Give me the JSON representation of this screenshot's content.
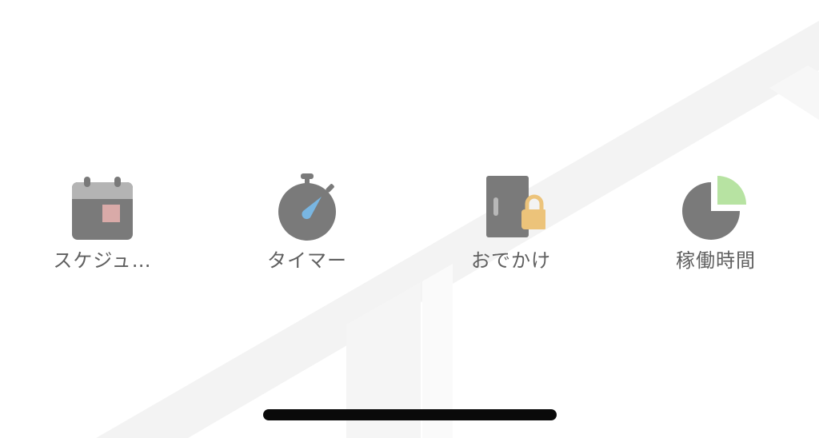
{
  "menu": {
    "items": [
      {
        "id": "schedule",
        "label": "スケジュ…",
        "icon": "calendar-icon"
      },
      {
        "id": "timer",
        "label": "タイマー",
        "icon": "stopwatch-icon"
      },
      {
        "id": "away",
        "label": "おでかけ",
        "icon": "door-lock-icon"
      },
      {
        "id": "runtime",
        "label": "稼働時間",
        "icon": "pie-chart-icon"
      }
    ]
  },
  "colors": {
    "icon_gray": "#7a7a7a",
    "calendar_header": "#b4b4b4",
    "calendar_mark": "#d9aaa8",
    "stopwatch_hand": "#79b6e2",
    "lock_gold": "#ecc37a",
    "pie_slice_green": "#b7e3a2",
    "label_text": "#5f5f5f",
    "background_graphic": "#f2f2f2"
  }
}
